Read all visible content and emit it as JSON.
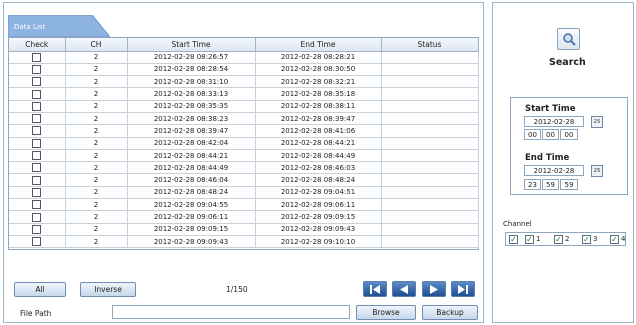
{
  "tab_label": "Data List",
  "table": {
    "headers": [
      "Check",
      "CH",
      "Start Time",
      "End Time",
      "Status"
    ],
    "rows": [
      {
        "ch": "2",
        "start": "2012-02-28 08:26:57",
        "end": "2012-02-28 08:28:21",
        "status": ""
      },
      {
        "ch": "2",
        "start": "2012-02-28 08:28:54",
        "end": "2012-02-28 08:30:50",
        "status": ""
      },
      {
        "ch": "2",
        "start": "2012-02-28 08:31:10",
        "end": "2012-02-28 08:32:21",
        "status": ""
      },
      {
        "ch": "2",
        "start": "2012-02-28 08:33:13",
        "end": "2012-02-28 08:35:18",
        "status": ""
      },
      {
        "ch": "2",
        "start": "2012-02-28 08:35:35",
        "end": "2012-02-28 08:38:11",
        "status": ""
      },
      {
        "ch": "2",
        "start": "2012-02-28 08:38:23",
        "end": "2012-02-28 08:39:47",
        "status": ""
      },
      {
        "ch": "2",
        "start": "2012-02-28 08:39:47",
        "end": "2012-02-28 08:41:06",
        "status": ""
      },
      {
        "ch": "2",
        "start": "2012-02-28 08:42:04",
        "end": "2012-02-28 08:44:21",
        "status": ""
      },
      {
        "ch": "2",
        "start": "2012-02-28 08:44:21",
        "end": "2012-02-28 08:44:49",
        "status": ""
      },
      {
        "ch": "2",
        "start": "2012-02-28 08:44:49",
        "end": "2012-02-28 08:46:03",
        "status": ""
      },
      {
        "ch": "2",
        "start": "2012-02-28 08:46:04",
        "end": "2012-02-28 08:48:24",
        "status": ""
      },
      {
        "ch": "2",
        "start": "2012-02-28 08:48:24",
        "end": "2012-02-28 09:04:51",
        "status": ""
      },
      {
        "ch": "2",
        "start": "2012-02-28 09:04:55",
        "end": "2012-02-28 09:06:11",
        "status": ""
      },
      {
        "ch": "2",
        "start": "2012-02-28 09:06:11",
        "end": "2012-02-28 09:09:15",
        "status": ""
      },
      {
        "ch": "2",
        "start": "2012-02-28 09:09:15",
        "end": "2012-02-28 09:09:43",
        "status": ""
      },
      {
        "ch": "2",
        "start": "2012-02-28 09:09:43",
        "end": "2012-02-28 09:10:10",
        "status": ""
      }
    ]
  },
  "buttons": {
    "all": "All",
    "inverse": "Inverse",
    "browse": "Browse",
    "backup": "Backup"
  },
  "pagination": {
    "indicator": "1/150"
  },
  "file_path": {
    "label": "File Path",
    "value": ""
  },
  "search": {
    "label": "Search"
  },
  "start_time": {
    "label": "Start Time",
    "date": "2012-02-28",
    "hour": "00",
    "minute": "00",
    "second": "00",
    "calendar": "25"
  },
  "end_time": {
    "label": "End Time",
    "date": "2012-02-28",
    "hour": "23",
    "minute": "59",
    "second": "59",
    "calendar": "25"
  },
  "channel": {
    "label": "Channel",
    "options": [
      {
        "label": "1",
        "checked": true
      },
      {
        "label": "2",
        "checked": true
      },
      {
        "label": "3",
        "checked": true
      },
      {
        "label": "4",
        "checked": true
      }
    ]
  },
  "colors": {
    "tab": "#7ea6d8",
    "nav_button": "#2d5fa3",
    "border": "#9fb3c8"
  },
  "icons": {
    "search": "magnifier-icon",
    "first": "first-page-icon",
    "prev": "prev-page-icon",
    "next": "next-page-icon",
    "last": "last-page-icon",
    "calendar": "calendar-icon"
  }
}
